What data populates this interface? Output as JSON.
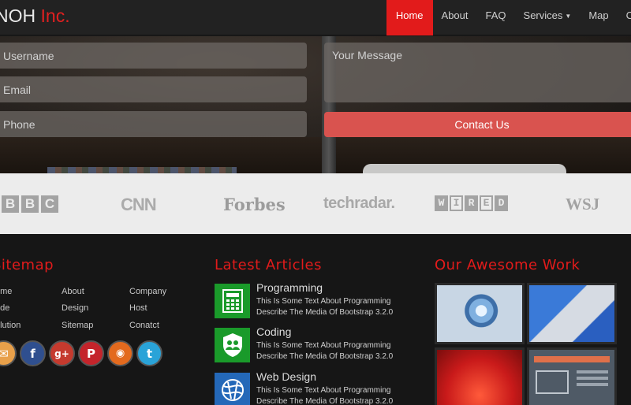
{
  "brand": {
    "name": "NOH",
    "suffix": " Inc."
  },
  "nav": {
    "items": [
      {
        "label": "Home",
        "active": true
      },
      {
        "label": "About"
      },
      {
        "label": "FAQ"
      },
      {
        "label": "Services",
        "dropdown": true
      },
      {
        "label": "Map"
      },
      {
        "label": "C"
      }
    ]
  },
  "contact_form": {
    "username_placeholder": "Username",
    "email_placeholder": "Email",
    "phone_placeholder": "Phone",
    "message_placeholder": "Your Message",
    "submit_label": "Contact Us"
  },
  "partners": {
    "bbc": [
      "B",
      "B",
      "C"
    ],
    "cnn": "CNN",
    "forbes": "Forbes",
    "techradar": "techradar.",
    "wired": [
      "W",
      "I",
      "R",
      "E",
      "D"
    ],
    "wsj": "WSJ"
  },
  "footer": {
    "sitemap": {
      "title": "Sitemap",
      "links": [
        "ome",
        "About",
        "Company",
        "ode",
        "Design",
        "Host",
        "olution",
        "Sitemap",
        "Conatct"
      ]
    },
    "socials": [
      "mail-icon",
      "facebook-icon",
      "google-plus-icon",
      "pinterest-icon",
      "rss-icon",
      "twitter-icon"
    ],
    "articles": {
      "title": "Latest Articles",
      "items": [
        {
          "title": "Programming",
          "line1": "This Is Some Text About Programming",
          "line2": "Describe The Media Of Bootstrap 3.2.0",
          "icon": "calculator-icon",
          "color": "#1a9a2a"
        },
        {
          "title": "Coding",
          "line1": "This Is Some Text About Programming",
          "line2": "Describe The Media Of Bootstrap 3.2.0",
          "icon": "shield-users-icon",
          "color": "#1a9a2a"
        },
        {
          "title": "Web Design",
          "line1": "This Is Some Text About Programming",
          "line2": "Describe The Media Of Bootstrap 3.2.0",
          "icon": "globe-icon",
          "color": "#2468b8"
        }
      ]
    },
    "work": {
      "title": "Our Awesome Work"
    }
  },
  "colors": {
    "accent": "#e21b1b",
    "button": "#d9534f",
    "logo_band": "#ececec",
    "footer_bg": "#161616"
  }
}
